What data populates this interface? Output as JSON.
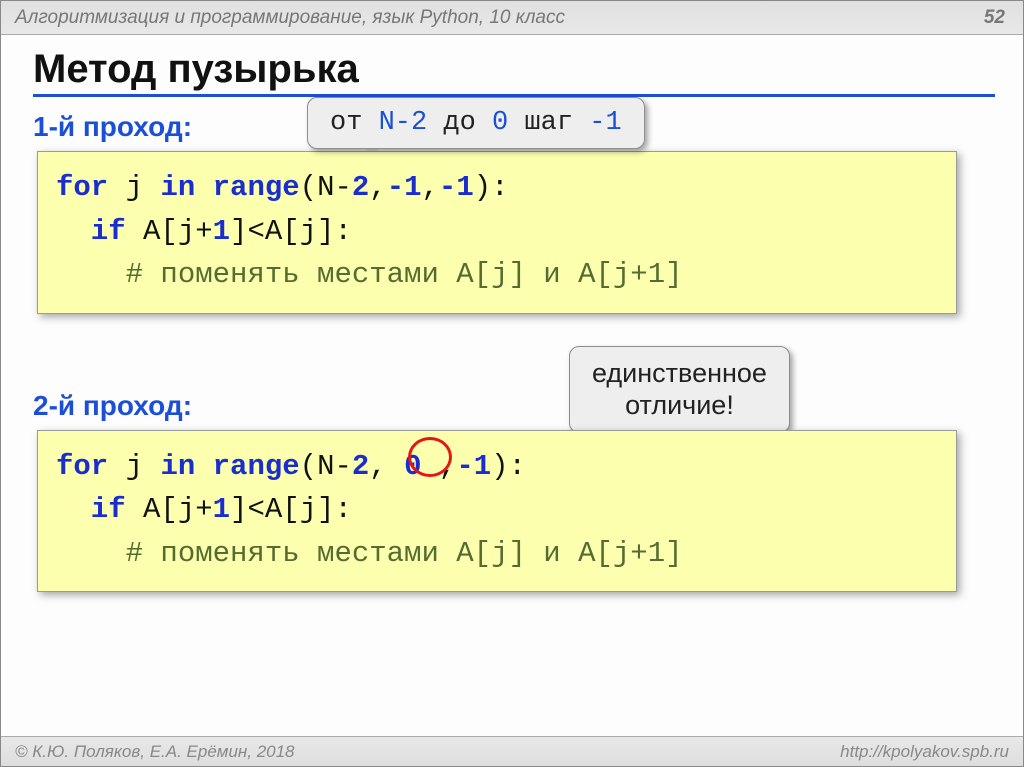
{
  "header": {
    "context": "Алгоритмизация и программирование, язык Python, 10 класс",
    "pagenum": "52"
  },
  "title": "Метод пузырька",
  "callout_top": {
    "t1": "от ",
    "v1": "N-2",
    "t2": " до ",
    "v2": "0",
    "t3": " шаг ",
    "v3": "-1"
  },
  "pass1": {
    "heading": "1-й проход:",
    "l1a": "for",
    "l1b": " j ",
    "l1c": "in range",
    "l1d": "(N-",
    "l1e": "2",
    "l1f": ",",
    "l1g": "-1",
    "l1h": ",",
    "l1i": "-1",
    "l1j": "):",
    "l2a": "  if",
    "l2b": " A[j+",
    "l2c": "1",
    "l2d": "]<A[j]:",
    "l3": "    # поменять местами A[j] и A[j+1]"
  },
  "callout_mid_l1": "единственное",
  "callout_mid_l2": "отличие!",
  "pass2": {
    "heading": "2-й проход:",
    "l1a": "for",
    "l1b": " j ",
    "l1c": "in range",
    "l1d": "(N-",
    "l1e": "2",
    "l1f": ",",
    "l1g": " 0 ",
    "l1h": ",",
    "l1i": "-1",
    "l1j": "):",
    "l2a": "  if",
    "l2b": " A[j+",
    "l2c": "1",
    "l2d": "]<A[j]:",
    "l3": "    # поменять местами A[j] и A[j+1]"
  },
  "footer": {
    "left": "© К.Ю. Поляков, Е.А. Ерёмин, 2018",
    "right": "http://kpolyakov.spb.ru"
  }
}
